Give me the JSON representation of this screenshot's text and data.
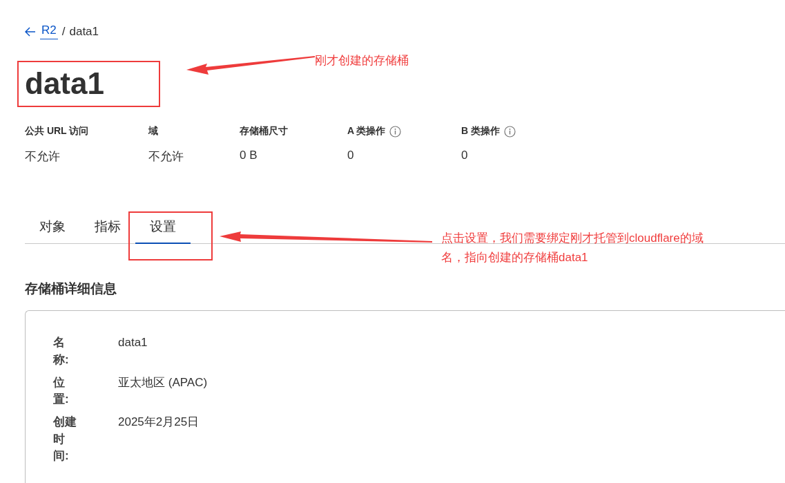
{
  "breadcrumb": {
    "back_link": "R2",
    "separator": "/",
    "current": "data1"
  },
  "title": "data1",
  "stats": [
    {
      "label": "公共 URL 访问",
      "value": "不允许",
      "info": false
    },
    {
      "label": "域",
      "value": "不允许",
      "info": false
    },
    {
      "label": "存储桶尺寸",
      "value": "0 B",
      "info": false
    },
    {
      "label": "A 类操作",
      "value": "0",
      "info": true
    },
    {
      "label": "B 类操作",
      "value": "0",
      "info": true
    }
  ],
  "tabs": [
    {
      "label": "对象",
      "selected": false
    },
    {
      "label": "指标",
      "selected": false
    },
    {
      "label": "设置",
      "selected": true
    }
  ],
  "details_section": {
    "title": "存储桶详细信息",
    "rows": [
      {
        "label": "名称:",
        "value": "data1"
      },
      {
        "label": "位置:",
        "value": "亚太地区 (APAC)"
      },
      {
        "label": "创建时间:",
        "value": "2025年2月25日"
      }
    ]
  },
  "annotations": [
    {
      "text": "刚才创建的存储桶"
    },
    {
      "text": "点击设置，我们需要绑定刚才托管到cloudflare的域名，指向创建的存储桶data1"
    }
  ]
}
